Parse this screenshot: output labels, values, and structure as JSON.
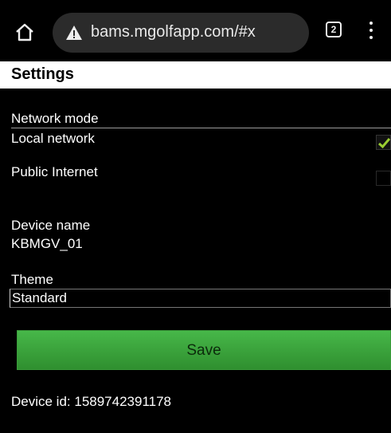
{
  "browser": {
    "url": "bams.mgolfapp.com/#x",
    "tab_count": "2"
  },
  "page": {
    "title": "Settings"
  },
  "network_mode": {
    "label": "Network mode",
    "options": [
      {
        "label": "Local network",
        "checked": true
      },
      {
        "label": "Public Internet",
        "checked": false
      }
    ]
  },
  "device": {
    "name_label": "Device name",
    "name_value": "KBMGV_01",
    "id_text": "Device id: 1589742391178"
  },
  "theme": {
    "label": "Theme",
    "selected": "Standard"
  },
  "actions": {
    "save_label": "Save"
  },
  "colors": {
    "accent": "#3fa83f",
    "check": "#9acd32"
  }
}
